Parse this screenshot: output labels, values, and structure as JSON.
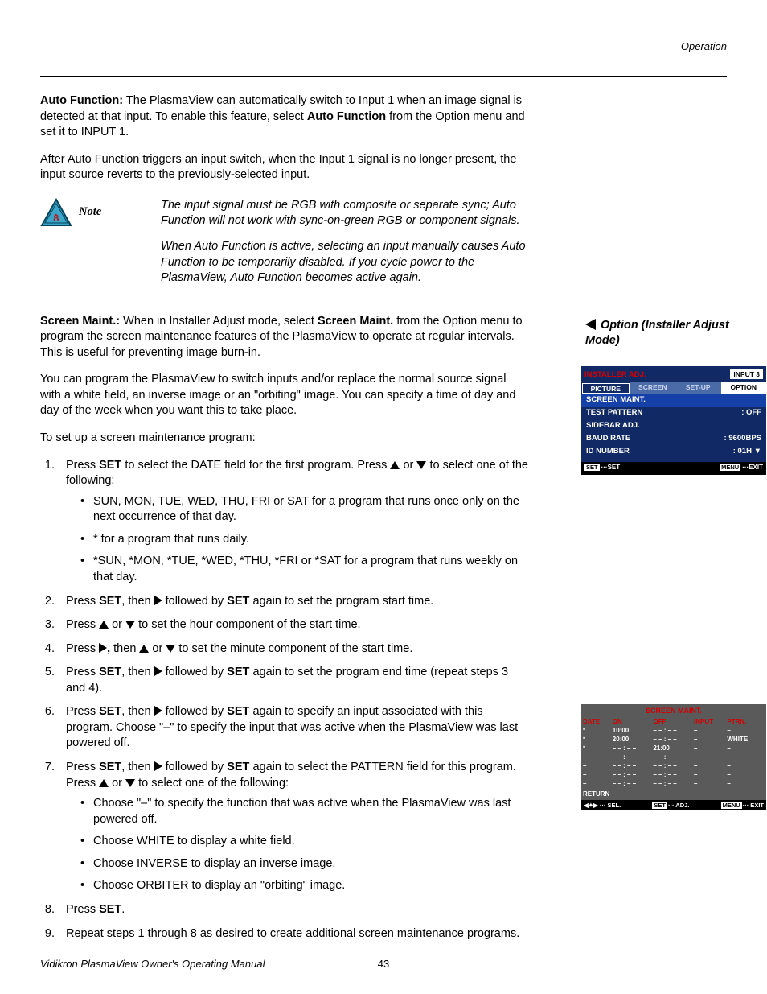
{
  "header": {
    "section": "Operation"
  },
  "para_auto_function": {
    "lead": "Auto Function:",
    "body": " The PlasmaView can automatically switch to Input 1 when an image signal is detected at that input. To enable this feature, select ",
    "bold2": "Auto Function",
    "tail": " from the Option menu and set it to INPUT 1."
  },
  "para_after": "After Auto Function triggers an input switch, when the Input 1 signal is no longer present, the input source reverts to the previously-selected input.",
  "note": {
    "label": "Note",
    "p1": "The input signal must be RGB with composite or separate sync; Auto Function will not work with sync-on-green RGB or component signals.",
    "p2": "When Auto Function is active, selecting an input manually causes Auto Function to be temporarily disabled. If you cycle power to the PlasmaView, Auto Function becomes active again."
  },
  "para_screen_maint": {
    "lead": "Screen Maint.:",
    "mid1": " When in Installer Adjust mode, select ",
    "bold2": "Screen Maint.",
    "tail": " from the Option menu to program the screen maintenance features of the PlasmaView to operate at regular intervals. This is useful for preventing image burn-in."
  },
  "para_program": "You can program the PlasmaView to switch inputs and/or replace the normal source signal with a white field, an inverse image or an \"orbiting\" image. You can specify a time of day and day of the week when you want this to take place.",
  "para_setup_lead": "To set up a screen maintenance program:",
  "steps": {
    "s1a": "Press ",
    "s1b": "SET",
    "s1c": " to select the DATE field for the first program. Press ",
    "s1d": " or ",
    "s1e": " to select one of the following:",
    "s1_sub1": "SUN, MON, TUE, WED, THU, FRI or SAT for a program that runs once only on the next occurrence of that day.",
    "s1_sub2": "* for a program that runs daily.",
    "s1_sub3": "*SUN, *MON, *TUE, *WED, *THU, *FRI or *SAT for a program that runs weekly on that day.",
    "s2a": "Press ",
    "s2b": "SET",
    "s2c": ", then ",
    "s2d": " followed by ",
    "s2e": "SET",
    "s2f": " again to set the program start time.",
    "s3a": "Press ",
    "s3b": " or ",
    "s3c": " to set the hour component of the start time.",
    "s4a": "Press ",
    "s4b": ", ",
    "s4c": "then ",
    "s4d": " or ",
    "s4e": " to set the minute component of the start time.",
    "s5a": "Press ",
    "s5b": "SET",
    "s5c": ", then ",
    "s5d": " followed by ",
    "s5e": "SET",
    "s5f": " again to set the program end time (repeat steps 3 and 4).",
    "s6a": "Press ",
    "s6b": "SET",
    "s6c": ", then ",
    "s6d": " followed by ",
    "s6e": "SET",
    "s6f": " again to specify an input associated with this program. Choose \"–\" to specify the input that was active when the PlasmaView was last powered off.",
    "s7a": "Press ",
    "s7b": "SET",
    "s7c": ", then ",
    "s7d": " followed by ",
    "s7e": "SET",
    "s7f": " again to select the PATTERN field for this program. Press ",
    "s7g": " or ",
    "s7h": " to select one of the following:",
    "s7_sub1": "Choose \"–\" to specify the function that was active when the PlasmaView was last powered off.",
    "s7_sub2": "Choose WHITE to display a white field.",
    "s7_sub3": "Choose INVERSE to display an inverse image.",
    "s7_sub4": "Choose ORBITER to display an \"orbiting\" image.",
    "s8a": "Press ",
    "s8b": "SET",
    "s8c": ".",
    "s9": "Repeat steps 1 through 8 as desired to create additional screen maintenance programs."
  },
  "side_heading": "Option (Installer Adjust Mode)",
  "osd": {
    "title": "INSTALLER ADJ.",
    "input_badge": "INPUT 3",
    "tabs": {
      "picture": "PICTURE",
      "screen": "SCREEN",
      "setup": "SET-UP",
      "option": "OPTION"
    },
    "items": [
      {
        "label": "SCREEN MAINT.",
        "value": "",
        "selected": true
      },
      {
        "label": "TEST PATTERN",
        "value": ":  OFF"
      },
      {
        "label": "SIDEBAR ADJ.",
        "value": ""
      },
      {
        "label": "BAUD RATE",
        "value": ":  9600BPS"
      },
      {
        "label": "ID NUMBER",
        "value": ":  01H     ▼"
      }
    ],
    "footer_left_pill": "SET",
    "footer_left_text": "···SET",
    "footer_right_pill": "MENU",
    "footer_right_text": "···EXIT"
  },
  "osd_table": {
    "title": "SCREEN MAINT.",
    "headers": [
      "DATE",
      "ON",
      "OFF",
      "INPUT",
      "PTRN."
    ],
    "rows": [
      [
        "*",
        "10:00",
        "– – : – –",
        "–",
        "–"
      ],
      [
        "*",
        "20:00",
        "– – : – –",
        "–",
        "WHITE"
      ],
      [
        "*",
        "– – : – –",
        "21:00",
        "–",
        "–"
      ],
      [
        "–",
        "– – : – –",
        "– – : – –",
        "–",
        "–"
      ],
      [
        "–",
        "– – : – –",
        "– – : – –",
        "–",
        "–"
      ],
      [
        "–",
        "– – : – –",
        "– – : – –",
        "–",
        "–"
      ],
      [
        "–",
        "– – : – –",
        "– – : – –",
        "–",
        "–"
      ]
    ],
    "return": "RETURN",
    "footer_left": "◀✦▶ ··· SEL.",
    "footer_mid_pill": "SET",
    "footer_mid_text": "··· ADJ.",
    "footer_right_pill": "MENU",
    "footer_right_text": "··· EXIT"
  },
  "footer": {
    "left": "Vidikron PlasmaView Owner's Operating Manual",
    "center": "43"
  }
}
